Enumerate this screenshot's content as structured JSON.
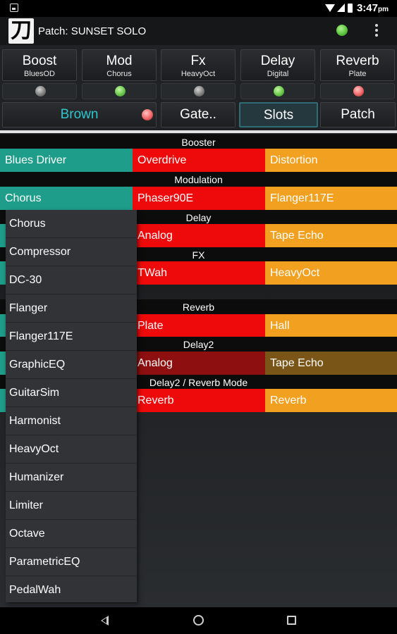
{
  "status_bar": {
    "time": "3:47",
    "time_suffix": "pm"
  },
  "app_bar": {
    "patch_title": "Patch: SUNSET SOLO",
    "logo_glyph": "刀",
    "status_led_color": "#55c23a"
  },
  "effect_blocks": [
    {
      "name": "Boost",
      "sub": "BluesOD",
      "led": "off"
    },
    {
      "name": "Mod",
      "sub": "Chorus",
      "led": "green"
    },
    {
      "name": "Fx",
      "sub": "HeavyOct",
      "led": "off"
    },
    {
      "name": "Delay",
      "sub": "Digital",
      "led": "green"
    },
    {
      "name": "Reverb",
      "sub": "Plate",
      "led": "red"
    }
  ],
  "row2": {
    "brown": "Brown",
    "gate": "Gate..",
    "slots": "Slots",
    "patch": "Patch"
  },
  "sections": {
    "booster": {
      "label": "Booster",
      "cells": [
        "Blues Driver",
        "Overdrive",
        "Distortion"
      ]
    },
    "modulation": {
      "label": "Modulation",
      "cells": [
        "Chorus",
        "Phaser90E",
        "Flanger117E"
      ]
    },
    "delay": {
      "label": "Delay",
      "cells": [
        "Analog",
        "Tape Echo"
      ]
    },
    "fx": {
      "label": "FX",
      "cells": [
        "TWah",
        "HeavyOct"
      ]
    },
    "reverb": {
      "label": "Reverb",
      "cells": [
        "Plate",
        "Hall"
      ]
    },
    "delay2": {
      "label": "Delay2",
      "cells": [
        "Analog",
        "Tape Echo"
      ]
    },
    "delay2_reverb_mode": {
      "label": "Delay2 / Reverb Mode",
      "cells": [
        "Reverb",
        "Reverb"
      ]
    }
  },
  "dropdown": {
    "items": [
      "Chorus",
      "Compressor",
      "DC-30",
      "Flanger",
      "Flanger117E",
      "GraphicEQ",
      "GuitarSim",
      "Harmonist",
      "HeavyOct",
      "Humanizer",
      "Limiter",
      "Octave",
      "ParametricEQ",
      "PedalWah"
    ]
  },
  "colors": {
    "teal": "#1e9e8a",
    "red": "#ee0a0a",
    "orange": "#f1a020",
    "dark_red": "#8e0f0f",
    "brown": "#7a5518",
    "accent_text": "#2fc6cf"
  }
}
